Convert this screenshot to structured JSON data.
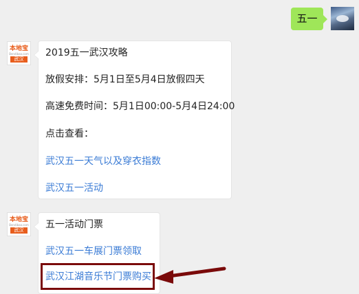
{
  "user_message": {
    "text": "五一"
  },
  "bot_avatar": {
    "logo_text": "本地宝",
    "logo_sub": "Bendibao.com",
    "city": "武汉"
  },
  "message_1": {
    "title": "2019五一武汉攻略",
    "holiday": "放假安排：5月1日至5月4日放假四天",
    "toll_free": "高速免费时间：5月1日00:00-5月4日24:00",
    "prompt": "点击查看：",
    "link_weather": "武汉五一天气以及穿衣指数",
    "link_events": "武汉五一活动"
  },
  "message_2": {
    "title": "五一活动门票",
    "link_car_show": "武汉五一车展门票领取",
    "link_music_festival": "武汉江湖音乐节门票购买"
  },
  "colors": {
    "user_bubble": "#9fe659",
    "link": "#3a7bd5",
    "highlight": "#7a0a0a",
    "brand": "#e85d1c"
  }
}
